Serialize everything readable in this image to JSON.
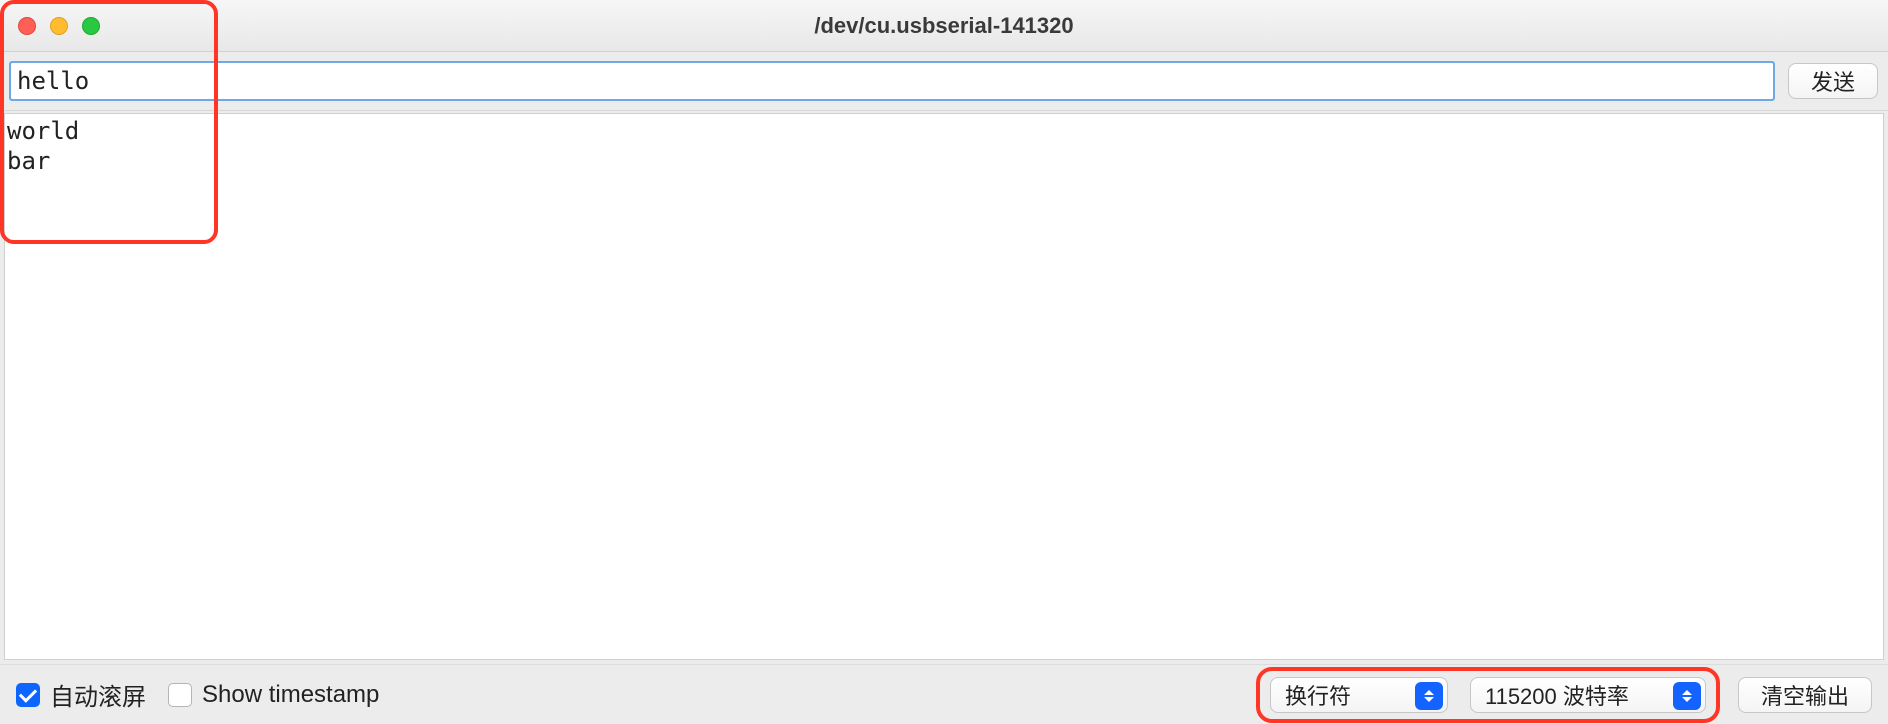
{
  "window": {
    "title": "/dev/cu.usbserial-141320"
  },
  "input": {
    "value": "hello",
    "send_label": "发送"
  },
  "output": {
    "text": "world\nbar"
  },
  "footer": {
    "autoscroll_label": "自动滚屏",
    "autoscroll_checked": true,
    "show_timestamp_label": "Show timestamp",
    "show_timestamp_checked": false,
    "line_ending_selected": "换行符",
    "baud_selected": "115200 波特率",
    "clear_label": "清空输出"
  }
}
